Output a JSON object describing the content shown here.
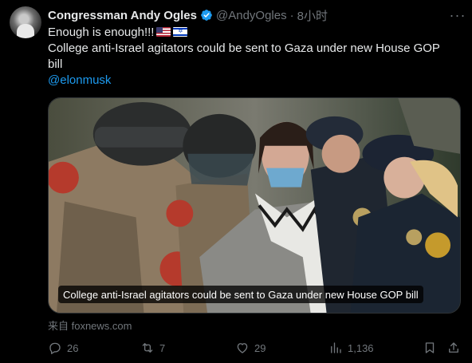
{
  "author": {
    "display_name": "Congressman Andy Ogles",
    "handle": "@AndyOgles",
    "separator": "·",
    "time": "8小时"
  },
  "tweet": {
    "line1": "Enough is enough!!!",
    "line2": "College anti-Israel agitators could be sent to Gaza under new House GOP",
    "line3": "bill",
    "mention": "@elonmusk",
    "flags": [
      "us-flag-icon",
      "israel-flag-icon"
    ]
  },
  "card": {
    "caption": "College anti-Israel agitators could be sent to Gaza under new House GOP bill",
    "source": "来自 foxnews.com"
  },
  "actions": {
    "replies": "26",
    "reposts": "7",
    "likes": "29",
    "views": "1,136"
  },
  "colors": {
    "background": "#000000",
    "text": "#e7e9ea",
    "muted": "#71767b",
    "link": "#1d9bf0",
    "verified": "#1d9bf0"
  }
}
